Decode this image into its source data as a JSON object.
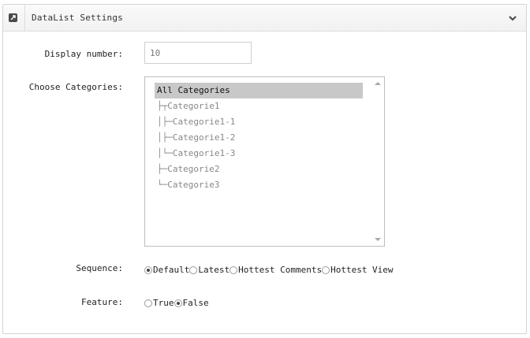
{
  "panel": {
    "title": "DataList Settings",
    "icon": "external-link-icon",
    "collapse_icon": "chevron-down-icon"
  },
  "form": {
    "display_number": {
      "label": "Display number:",
      "value": "10"
    },
    "categories": {
      "label": "Choose Categories:",
      "options": [
        {
          "text": "All Categories",
          "selected": true
        },
        {
          "text": "├┬Categorie1",
          "selected": false
        },
        {
          "text": "│├─Categorie1-1",
          "selected": false
        },
        {
          "text": "│├─Categorie1-2",
          "selected": false
        },
        {
          "text": "│└─Categorie1-3",
          "selected": false
        },
        {
          "text": "├─Categorie2",
          "selected": false
        },
        {
          "text": "└─Categorie3",
          "selected": false
        }
      ]
    },
    "sequence": {
      "label": "Sequence:",
      "options": [
        {
          "text": "Default",
          "checked": true
        },
        {
          "text": "Latest",
          "checked": false
        },
        {
          "text": "Hottest Comments",
          "checked": false
        },
        {
          "text": "Hottest View",
          "checked": false
        }
      ]
    },
    "feature": {
      "label": "Feature:",
      "options": [
        {
          "text": "True",
          "checked": false
        },
        {
          "text": "False",
          "checked": true
        }
      ]
    }
  }
}
